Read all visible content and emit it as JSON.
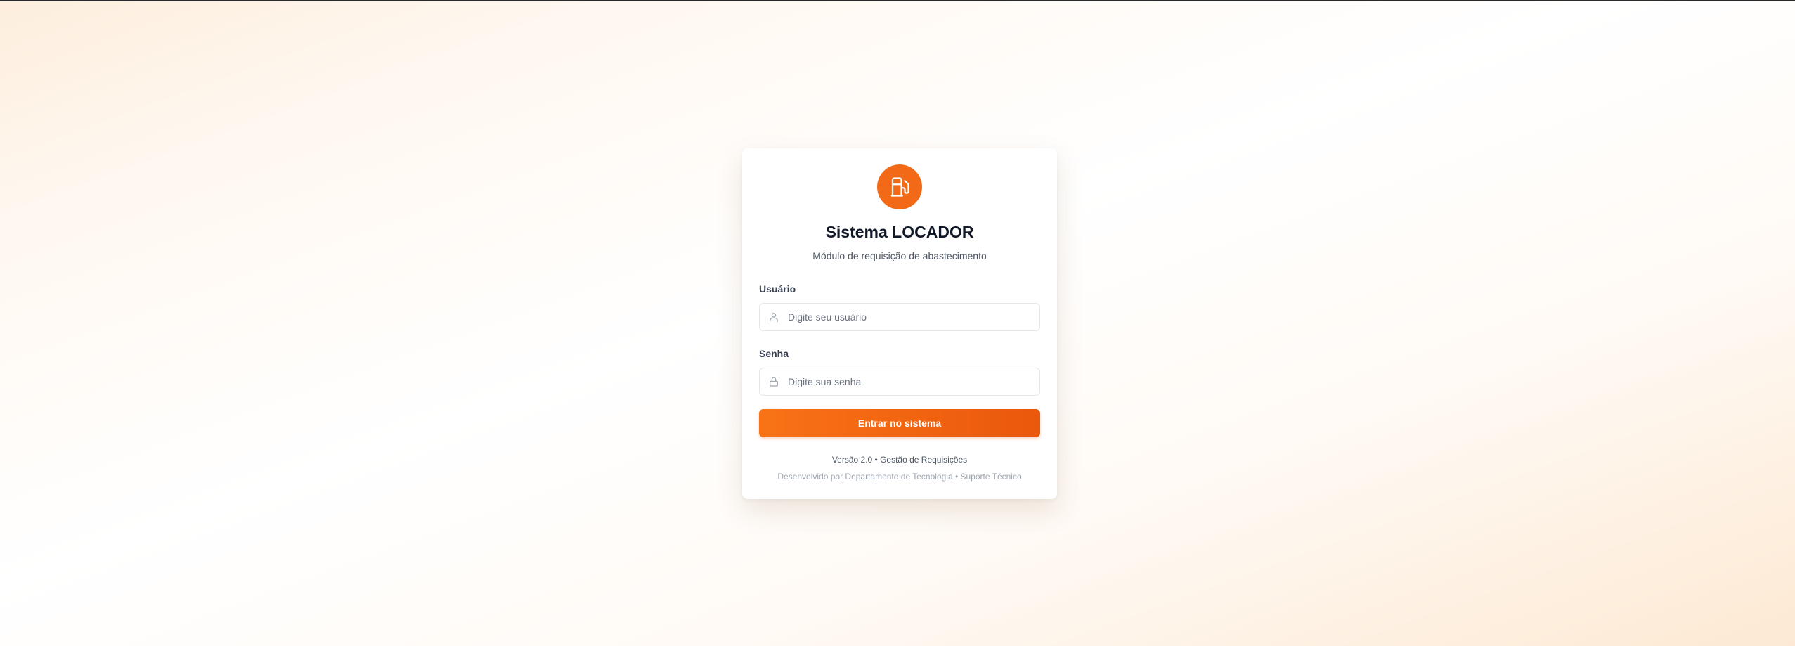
{
  "app": {
    "title": "Sistema LOCADOR",
    "subtitle": "Módulo de requisição de abastecimento",
    "logo_icon": "fuel-pump-icon"
  },
  "form": {
    "username": {
      "label": "Usuário",
      "placeholder": "Digite seu usuário",
      "value": "",
      "icon": "user-icon"
    },
    "password": {
      "label": "Senha",
      "placeholder": "Digite sua senha",
      "value": "",
      "icon": "lock-icon"
    },
    "submit_label": "Entrar no sistema"
  },
  "footer": {
    "version_line": "Versão 2.0 • Gestão de Requisições",
    "credits_line": "Desenvolvido por Departamento de Tecnologia • Suporte Técnico"
  },
  "colors": {
    "accent": "#f26a18",
    "accent_dark": "#ea580c",
    "title": "#111827",
    "muted": "#9ca3af"
  }
}
